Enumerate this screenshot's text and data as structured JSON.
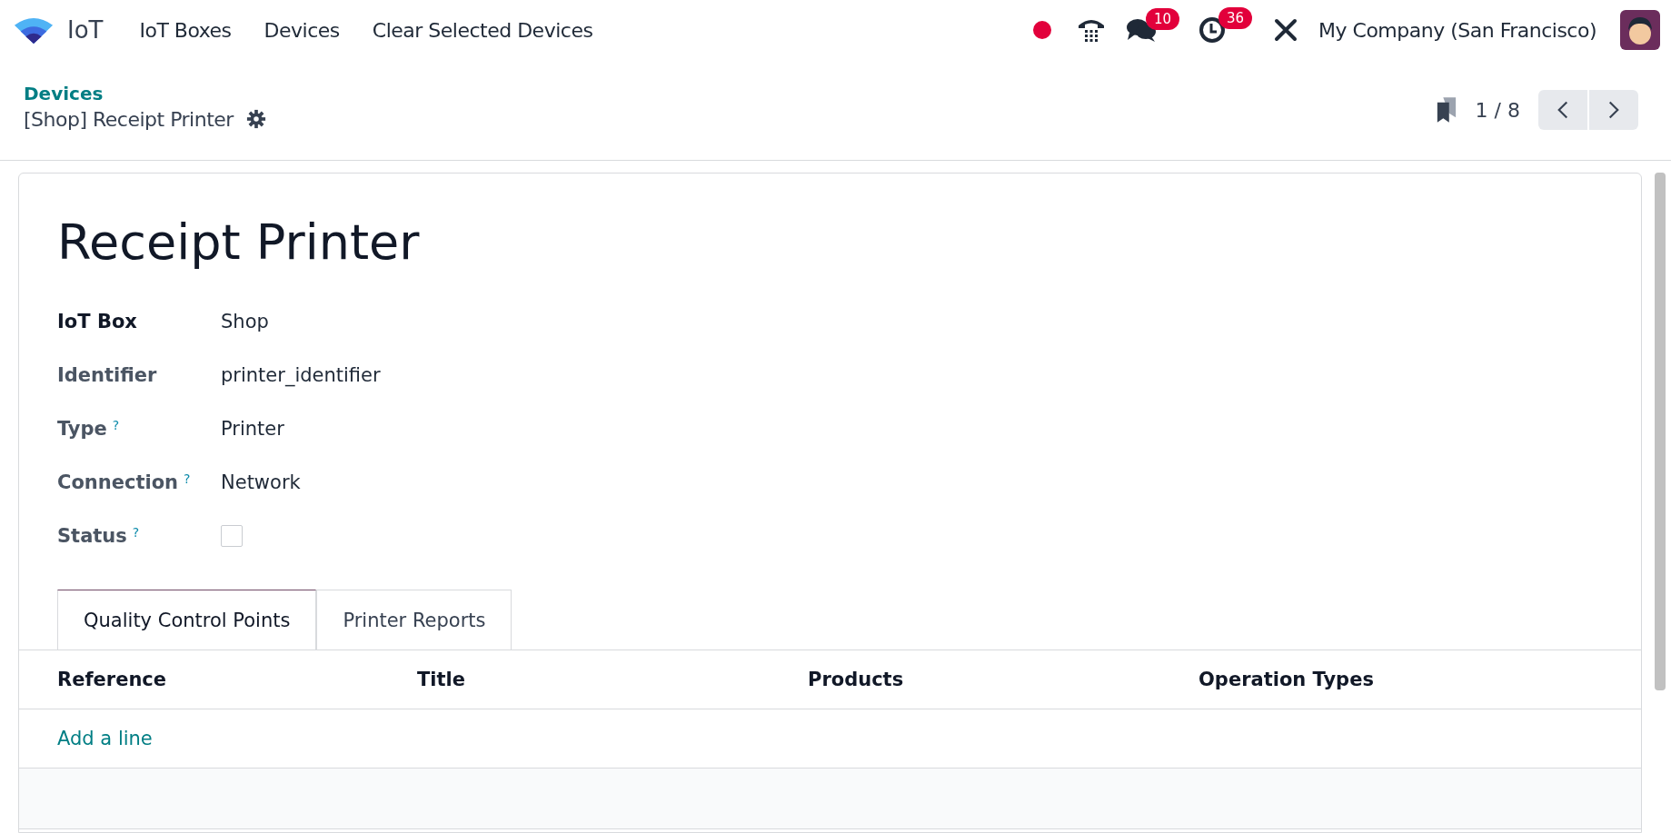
{
  "navbar": {
    "app_name": "IoT",
    "menu": [
      "IoT Boxes",
      "Devices",
      "Clear Selected Devices"
    ],
    "messages_count": "10",
    "activities_count": "36",
    "company": "My Company (San Francisco)"
  },
  "breadcrumb": {
    "parent": "Devices",
    "current": "[Shop] Receipt Printer"
  },
  "pager": {
    "value": "1 / 8"
  },
  "record": {
    "title": "Receipt Printer",
    "fields": [
      {
        "label": "IoT Box",
        "kind": "text",
        "value": "Shop",
        "help": false,
        "bold": true
      },
      {
        "label": "Identifier",
        "kind": "text",
        "value": "printer_identifier",
        "help": false,
        "bold": false
      },
      {
        "label": "Type",
        "kind": "text",
        "value": "Printer",
        "help": true,
        "bold": false
      },
      {
        "label": "Connection",
        "kind": "text",
        "value": "Network",
        "help": true,
        "bold": false
      },
      {
        "label": "Status",
        "kind": "checkbox",
        "checked": false,
        "help": true,
        "bold": false
      }
    ],
    "help_mark": "?"
  },
  "tabs": [
    {
      "label": "Quality Control Points",
      "selected": true
    },
    {
      "label": "Printer Reports",
      "selected": false
    }
  ],
  "table": {
    "columns": [
      "Reference",
      "Title",
      "Products",
      "Operation Types"
    ],
    "add_line": "Add a line"
  }
}
